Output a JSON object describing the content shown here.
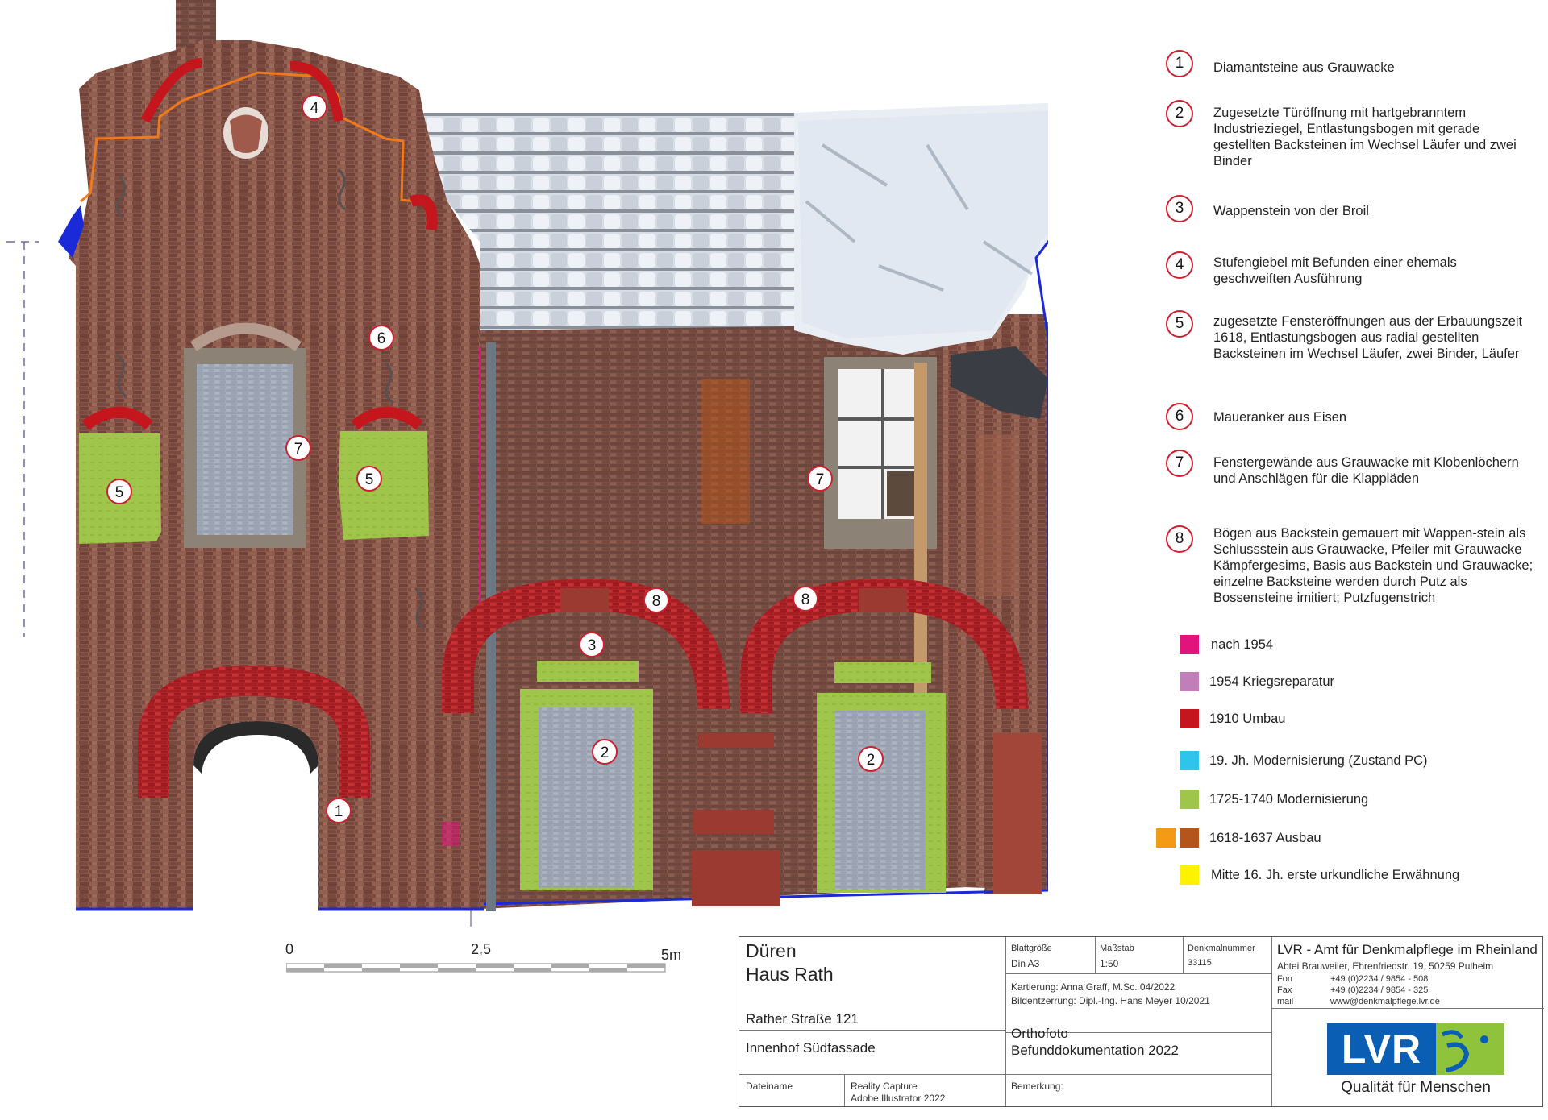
{
  "legend": {
    "items": [
      {
        "num": "1",
        "text": "Diamantsteine aus Grauwacke"
      },
      {
        "num": "2",
        "text": "Zugesetzte Türöffnung mit  hartgebranntem Industrieziegel, Entlastungsbogen mit gerade gestellten Backsteinen im Wechsel Läufer und zwei Binder"
      },
      {
        "num": "3",
        "text": "Wappenstein von der Broil"
      },
      {
        "num": "4",
        "text": "Stufengiebel mit Befunden einer ehemals geschweiften Ausführung"
      },
      {
        "num": "5",
        "text": "zugesetzte Fensteröffnungen aus der Erbauungszeit 1618, Entlastungsbogen aus radial gestellten Backsteinen im Wechsel Läufer, zwei Binder, Läufer"
      },
      {
        "num": "6",
        "text": "Maueranker aus Eisen"
      },
      {
        "num": "7",
        "text": "Fenstergewände aus Grauwacke mit Klobenlöchern und Anschlägen für die Klappläden"
      },
      {
        "num": "8",
        "text": "Bögen aus Backstein gemauert mit Wappen-stein als Schlussstein aus Grauwacke, Pfeiler mit Grauwacke Kämpfergesims, Basis aus Backstein und Grauwacke; einzelne Backsteine werden durch Putz als Bossensteine imitiert; Putzfugenstrich"
      }
    ],
    "phases": [
      {
        "label": "nach 1954",
        "colors": [
          "#e0147c"
        ]
      },
      {
        "label": "1954 Kriegsreparatur",
        "colors": [
          "#c07fb8"
        ]
      },
      {
        "label": "1910 Umbau",
        "colors": [
          "#c4161c"
        ]
      },
      {
        "label": "19. Jh. Modernisierung (Zustand PC)",
        "colors": [
          "#2ec4ec"
        ]
      },
      {
        "label": "1725-1740 Modernisierung",
        "colors": [
          "#9fc54a"
        ]
      },
      {
        "label": "1618-1637 Ausbau",
        "colors": [
          "#f49a16",
          "#b5541b"
        ]
      },
      {
        "label": "Mitte 16. Jh. erste urkundliche Erwähnung",
        "colors": [
          "#fff200"
        ]
      }
    ]
  },
  "markers": [
    "1",
    "2",
    "2",
    "3",
    "4",
    "5",
    "5",
    "6",
    "7",
    "7",
    "8",
    "8"
  ],
  "scale": {
    "zero": "0",
    "mid": "2,5",
    "end": "5m"
  },
  "titleblock": {
    "city": "Düren",
    "building": "Haus Rath",
    "street": "Rather Straße 121",
    "view": "Innenhof Südfassade",
    "sheet_label": "Blattgröße",
    "sheet_value": "Din A3",
    "scale_label": "Maßstab",
    "scale_value": "1:50",
    "monument_label": "Denkmalnummer",
    "monument_value": "33115",
    "mapping": "Kartierung: Anna Graff, M.Sc. 04/2022",
    "rectification": "Bildentzerrung: Dipl.-Ing. Hans Meyer 10/2021",
    "type1": "Orthofoto",
    "type2": "Befunddokumentation 2022",
    "file_label": "Dateiname",
    "file_line1": "Reality Capture",
    "file_line2": "Adobe Illustrator 2022",
    "remark_label": "Bemerkung:",
    "org_name": "LVR - Amt für Denkmalpflege im Rheinland",
    "org_address": "Abtei Brauweiler, Ehrenfriedstr. 19, 50259 Pulheim",
    "fon_label": "Fon",
    "fon": "+49 (0)2234 / 9854 - 508",
    "fax_label": "Fax",
    "fax": "+49 (0)2234 / 9854 - 325",
    "mail_label": "mail",
    "mail": "www@denkmalpflege.lvr.de",
    "logo_text": "LVR",
    "slogan": "Qualität für Menschen"
  },
  "colors": {
    "brick": "#8a5548",
    "mortar": "#a07a6e",
    "green": "#9fc54a",
    "red": "#c4161c",
    "blue_gray": "#9ea6b4",
    "roof": "#d8dfe8",
    "lvr_blue": "#0a5fb4",
    "lvr_green": "#8fc33c"
  }
}
